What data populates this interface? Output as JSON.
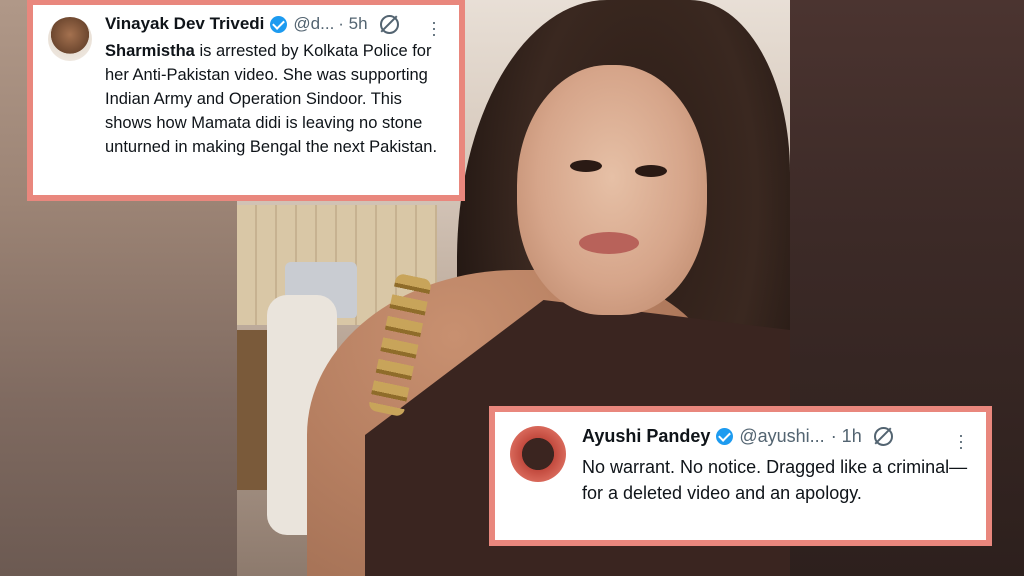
{
  "tweets": [
    {
      "name": "Vinayak Dev Trivedi",
      "handle": "@d...",
      "time": "· 5h",
      "mention": "Sharmistha",
      "text": " is arrested by Kolkata Police for her Anti-Pakistan video. She was supporting Indian Army and Operation Sindoor. This shows how Mamata didi is leaving no stone unturned in making Bengal the next Pakistan."
    },
    {
      "name": "Ayushi Pandey",
      "handle": "@ayushi...",
      "time": "· 1h",
      "text": "No warrant. No notice. Dragged like a criminal—for a deleted video and an apology."
    }
  ],
  "icons": {
    "verified": "verified-badge-icon",
    "grok": "grok-icon",
    "more": "more-options-icon"
  },
  "colors": {
    "card_border": "#e9877d",
    "verified": "#1d9bf0"
  }
}
